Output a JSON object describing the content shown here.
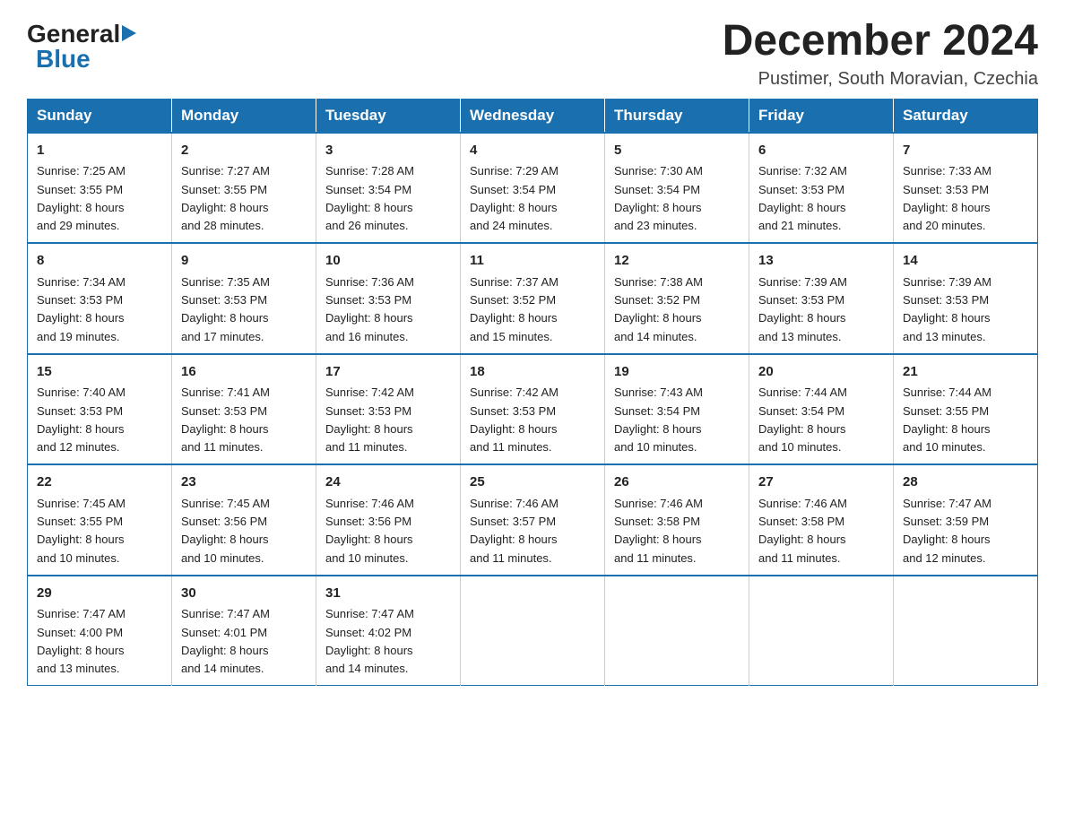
{
  "logo": {
    "general": "General",
    "blue": "Blue"
  },
  "title": "December 2024",
  "subtitle": "Pustimer, South Moravian, Czechia",
  "weekdays": [
    "Sunday",
    "Monday",
    "Tuesday",
    "Wednesday",
    "Thursday",
    "Friday",
    "Saturday"
  ],
  "weeks": [
    [
      {
        "day": "1",
        "sunrise": "Sunrise: 7:25 AM",
        "sunset": "Sunset: 3:55 PM",
        "daylight": "Daylight: 8 hours",
        "minutes": "and 29 minutes."
      },
      {
        "day": "2",
        "sunrise": "Sunrise: 7:27 AM",
        "sunset": "Sunset: 3:55 PM",
        "daylight": "Daylight: 8 hours",
        "minutes": "and 28 minutes."
      },
      {
        "day": "3",
        "sunrise": "Sunrise: 7:28 AM",
        "sunset": "Sunset: 3:54 PM",
        "daylight": "Daylight: 8 hours",
        "minutes": "and 26 minutes."
      },
      {
        "day": "4",
        "sunrise": "Sunrise: 7:29 AM",
        "sunset": "Sunset: 3:54 PM",
        "daylight": "Daylight: 8 hours",
        "minutes": "and 24 minutes."
      },
      {
        "day": "5",
        "sunrise": "Sunrise: 7:30 AM",
        "sunset": "Sunset: 3:54 PM",
        "daylight": "Daylight: 8 hours",
        "minutes": "and 23 minutes."
      },
      {
        "day": "6",
        "sunrise": "Sunrise: 7:32 AM",
        "sunset": "Sunset: 3:53 PM",
        "daylight": "Daylight: 8 hours",
        "minutes": "and 21 minutes."
      },
      {
        "day": "7",
        "sunrise": "Sunrise: 7:33 AM",
        "sunset": "Sunset: 3:53 PM",
        "daylight": "Daylight: 8 hours",
        "minutes": "and 20 minutes."
      }
    ],
    [
      {
        "day": "8",
        "sunrise": "Sunrise: 7:34 AM",
        "sunset": "Sunset: 3:53 PM",
        "daylight": "Daylight: 8 hours",
        "minutes": "and 19 minutes."
      },
      {
        "day": "9",
        "sunrise": "Sunrise: 7:35 AM",
        "sunset": "Sunset: 3:53 PM",
        "daylight": "Daylight: 8 hours",
        "minutes": "and 17 minutes."
      },
      {
        "day": "10",
        "sunrise": "Sunrise: 7:36 AM",
        "sunset": "Sunset: 3:53 PM",
        "daylight": "Daylight: 8 hours",
        "minutes": "and 16 minutes."
      },
      {
        "day": "11",
        "sunrise": "Sunrise: 7:37 AM",
        "sunset": "Sunset: 3:52 PM",
        "daylight": "Daylight: 8 hours",
        "minutes": "and 15 minutes."
      },
      {
        "day": "12",
        "sunrise": "Sunrise: 7:38 AM",
        "sunset": "Sunset: 3:52 PM",
        "daylight": "Daylight: 8 hours",
        "minutes": "and 14 minutes."
      },
      {
        "day": "13",
        "sunrise": "Sunrise: 7:39 AM",
        "sunset": "Sunset: 3:53 PM",
        "daylight": "Daylight: 8 hours",
        "minutes": "and 13 minutes."
      },
      {
        "day": "14",
        "sunrise": "Sunrise: 7:39 AM",
        "sunset": "Sunset: 3:53 PM",
        "daylight": "Daylight: 8 hours",
        "minutes": "and 13 minutes."
      }
    ],
    [
      {
        "day": "15",
        "sunrise": "Sunrise: 7:40 AM",
        "sunset": "Sunset: 3:53 PM",
        "daylight": "Daylight: 8 hours",
        "minutes": "and 12 minutes."
      },
      {
        "day": "16",
        "sunrise": "Sunrise: 7:41 AM",
        "sunset": "Sunset: 3:53 PM",
        "daylight": "Daylight: 8 hours",
        "minutes": "and 11 minutes."
      },
      {
        "day": "17",
        "sunrise": "Sunrise: 7:42 AM",
        "sunset": "Sunset: 3:53 PM",
        "daylight": "Daylight: 8 hours",
        "minutes": "and 11 minutes."
      },
      {
        "day": "18",
        "sunrise": "Sunrise: 7:42 AM",
        "sunset": "Sunset: 3:53 PM",
        "daylight": "Daylight: 8 hours",
        "minutes": "and 11 minutes."
      },
      {
        "day": "19",
        "sunrise": "Sunrise: 7:43 AM",
        "sunset": "Sunset: 3:54 PM",
        "daylight": "Daylight: 8 hours",
        "minutes": "and 10 minutes."
      },
      {
        "day": "20",
        "sunrise": "Sunrise: 7:44 AM",
        "sunset": "Sunset: 3:54 PM",
        "daylight": "Daylight: 8 hours",
        "minutes": "and 10 minutes."
      },
      {
        "day": "21",
        "sunrise": "Sunrise: 7:44 AM",
        "sunset": "Sunset: 3:55 PM",
        "daylight": "Daylight: 8 hours",
        "minutes": "and 10 minutes."
      }
    ],
    [
      {
        "day": "22",
        "sunrise": "Sunrise: 7:45 AM",
        "sunset": "Sunset: 3:55 PM",
        "daylight": "Daylight: 8 hours",
        "minutes": "and 10 minutes."
      },
      {
        "day": "23",
        "sunrise": "Sunrise: 7:45 AM",
        "sunset": "Sunset: 3:56 PM",
        "daylight": "Daylight: 8 hours",
        "minutes": "and 10 minutes."
      },
      {
        "day": "24",
        "sunrise": "Sunrise: 7:46 AM",
        "sunset": "Sunset: 3:56 PM",
        "daylight": "Daylight: 8 hours",
        "minutes": "and 10 minutes."
      },
      {
        "day": "25",
        "sunrise": "Sunrise: 7:46 AM",
        "sunset": "Sunset: 3:57 PM",
        "daylight": "Daylight: 8 hours",
        "minutes": "and 11 minutes."
      },
      {
        "day": "26",
        "sunrise": "Sunrise: 7:46 AM",
        "sunset": "Sunset: 3:58 PM",
        "daylight": "Daylight: 8 hours",
        "minutes": "and 11 minutes."
      },
      {
        "day": "27",
        "sunrise": "Sunrise: 7:46 AM",
        "sunset": "Sunset: 3:58 PM",
        "daylight": "Daylight: 8 hours",
        "minutes": "and 11 minutes."
      },
      {
        "day": "28",
        "sunrise": "Sunrise: 7:47 AM",
        "sunset": "Sunset: 3:59 PM",
        "daylight": "Daylight: 8 hours",
        "minutes": "and 12 minutes."
      }
    ],
    [
      {
        "day": "29",
        "sunrise": "Sunrise: 7:47 AM",
        "sunset": "Sunset: 4:00 PM",
        "daylight": "Daylight: 8 hours",
        "minutes": "and 13 minutes."
      },
      {
        "day": "30",
        "sunrise": "Sunrise: 7:47 AM",
        "sunset": "Sunset: 4:01 PM",
        "daylight": "Daylight: 8 hours",
        "minutes": "and 14 minutes."
      },
      {
        "day": "31",
        "sunrise": "Sunrise: 7:47 AM",
        "sunset": "Sunset: 4:02 PM",
        "daylight": "Daylight: 8 hours",
        "minutes": "and 14 minutes."
      },
      null,
      null,
      null,
      null
    ]
  ]
}
